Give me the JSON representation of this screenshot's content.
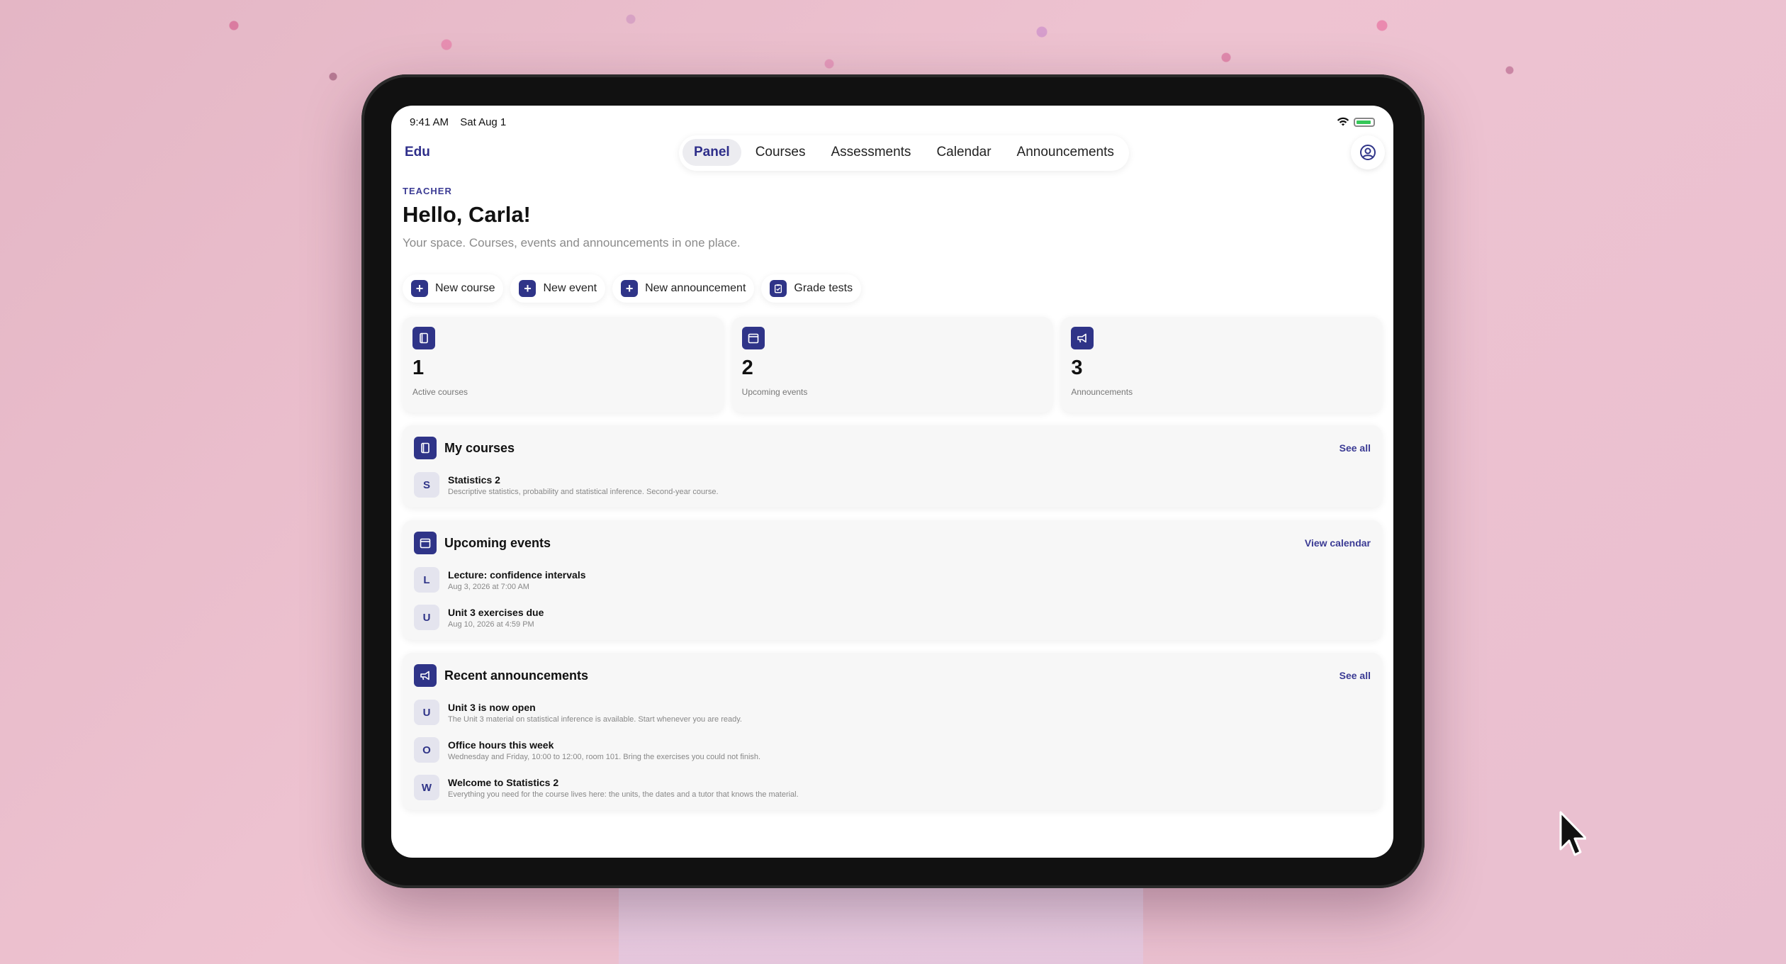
{
  "status_bar": {
    "time": "9:41 AM",
    "date": "Sat Aug 1"
  },
  "nav": {
    "brand": "Edu",
    "tabs": [
      "Panel",
      "Courses",
      "Assessments",
      "Calendar",
      "Announcements"
    ],
    "active_tab": "Panel"
  },
  "header": {
    "eyebrow": "TEACHER",
    "greeting": "Hello, Carla!",
    "subtitle": "Your space. Courses, events and announcements in one place."
  },
  "actions": [
    "New course",
    "New event",
    "New announcement",
    "Grade tests"
  ],
  "stats": [
    {
      "value": "1",
      "label": "Active courses",
      "icon": "book-icon"
    },
    {
      "value": "2",
      "label": "Upcoming events",
      "icon": "calendar-icon"
    },
    {
      "value": "3",
      "label": "Announcements",
      "icon": "megaphone-icon"
    }
  ],
  "my_courses": {
    "title": "My courses",
    "link": "See all",
    "items": [
      {
        "letter": "S",
        "title": "Statistics 2",
        "subtitle": "Descriptive statistics, probability and statistical inference. Second-year course."
      }
    ]
  },
  "upcoming_events": {
    "title": "Upcoming events",
    "link": "View calendar",
    "items": [
      {
        "letter": "L",
        "title": "Lecture: confidence intervals",
        "subtitle": "Aug 3, 2026 at 7:00 AM"
      },
      {
        "letter": "U",
        "title": "Unit 3 exercises due",
        "subtitle": "Aug 10, 2026 at 4:59 PM"
      }
    ]
  },
  "recent_announcements": {
    "title": "Recent announcements",
    "link": "See all",
    "items": [
      {
        "letter": "U",
        "title": "Unit 3 is now open",
        "subtitle": "The Unit 3 material on statistical inference is available. Start whenever you are ready."
      },
      {
        "letter": "O",
        "title": "Office hours this week",
        "subtitle": "Wednesday and Friday, 10:00 to 12:00, room 101. Bring the exercises you could not finish."
      },
      {
        "letter": "W",
        "title": "Welcome to Statistics 2",
        "subtitle": "Everything you need for the course lives here: the units, the dates and a tutor that knows the material."
      }
    ]
  },
  "colors": {
    "accent": "#2f3488",
    "link": "#3b3b94",
    "card": "#f7f7f7"
  }
}
